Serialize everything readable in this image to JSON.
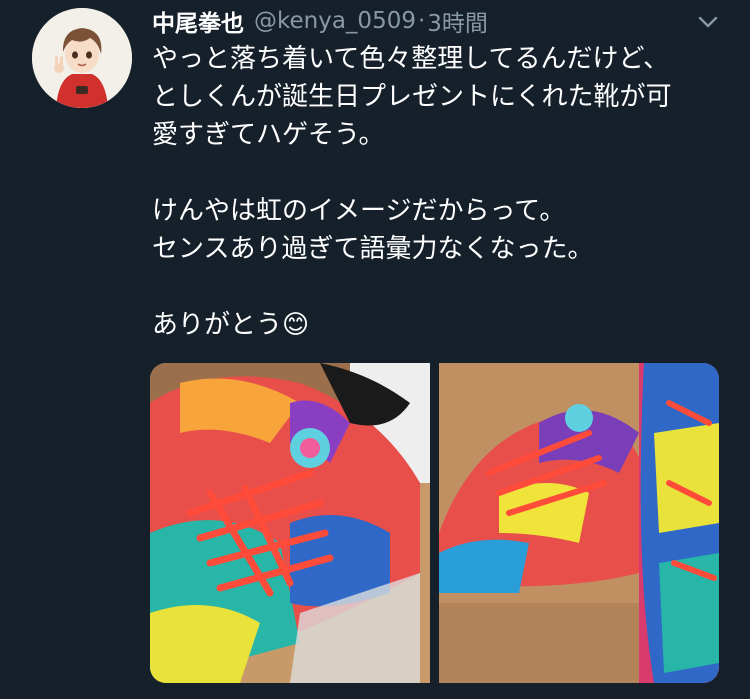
{
  "tweet": {
    "author_name": "中尾拳也",
    "handle": "@kenya_0509",
    "separator": "·",
    "time": "3時間",
    "lines": [
      "やっと落ち着いて色々整理してるんだけど、",
      "としくんが誕生日プレゼントにくれた靴が可",
      "愛すぎてハゲそう。",
      "",
      "けんやは虹のイメージだからって。",
      "センスあり過ぎて語彙力なくなった。",
      "",
      "ありがとう😊"
    ]
  },
  "icons": {
    "avatar": "avatar",
    "menu": "chevron-down-icon",
    "emoji": "smiling-face-emoji"
  },
  "colors": {
    "background": "#15202b",
    "text_primary": "#ffffff",
    "text_secondary": "#8899a6"
  }
}
